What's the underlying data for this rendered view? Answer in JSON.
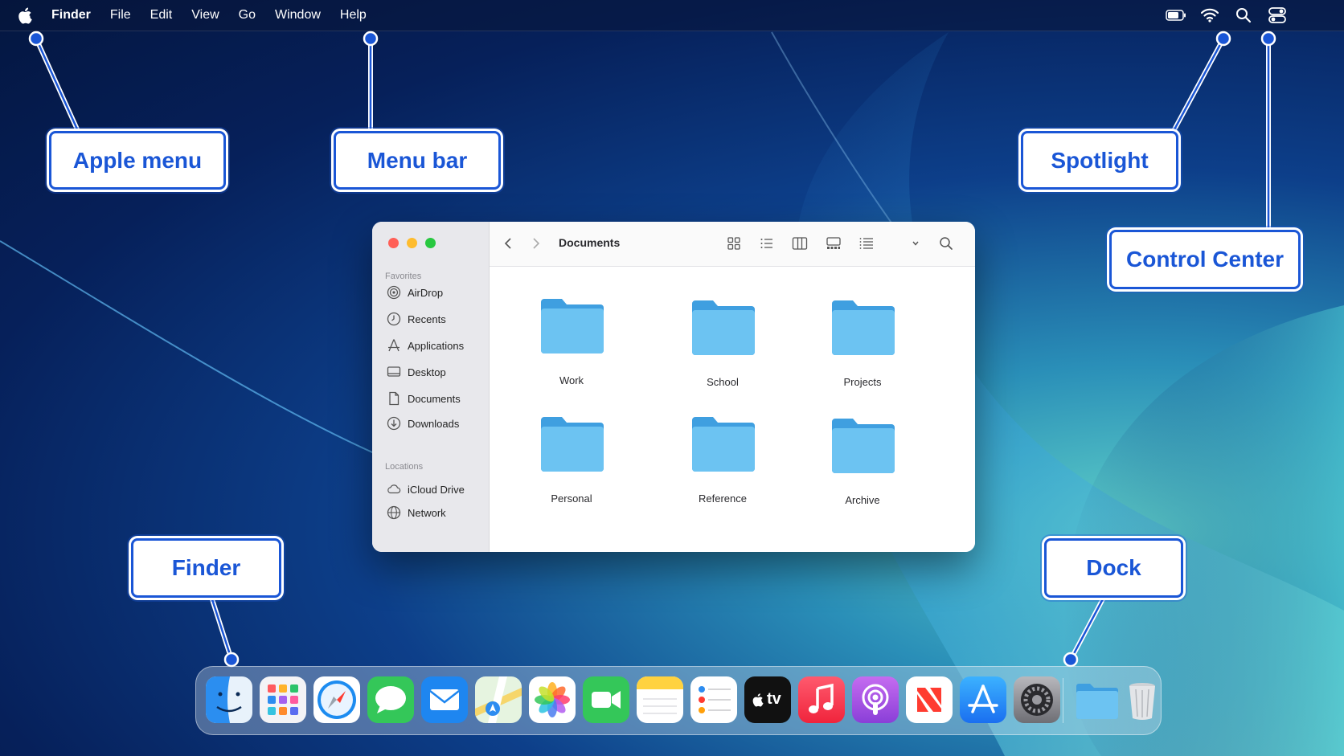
{
  "menubar": {
    "app_name": "Finder",
    "items": [
      "File",
      "Edit",
      "View",
      "Go",
      "Window",
      "Help"
    ]
  },
  "callouts": {
    "apple_menu": "Apple menu",
    "menu_bar": "Menu bar",
    "spotlight": "Spotlight",
    "control_center": "Control Center",
    "finder": "Finder",
    "dock": "Dock"
  },
  "finder_window": {
    "title": "Documents",
    "sidebar": {
      "favorites_label": "Favorites",
      "favorites": [
        "AirDrop",
        "Recents",
        "Applications",
        "Desktop",
        "Documents",
        "Downloads"
      ],
      "locations_label": "Locations",
      "locations": [
        "iCloud Drive",
        "Network"
      ]
    },
    "folders": [
      "Work",
      "School",
      "Projects",
      "Personal",
      "Reference",
      "Archive"
    ]
  },
  "dock": {
    "apps": [
      "Finder",
      "Launchpad",
      "Safari",
      "Messages",
      "Mail",
      "Maps",
      "Photos",
      "FaceTime",
      "Notes",
      "Reminders",
      "Apple TV",
      "Music",
      "Podcasts",
      "News",
      "App Store",
      "System Settings",
      "Downloads folder",
      "Trash"
    ],
    "tv_label": "tv"
  },
  "colors": {
    "callout_blue": "#1a56d6",
    "folder_blue": "#6cc3f2",
    "close": "#ff5f57",
    "minimize": "#febc2e",
    "zoom": "#28c840"
  }
}
